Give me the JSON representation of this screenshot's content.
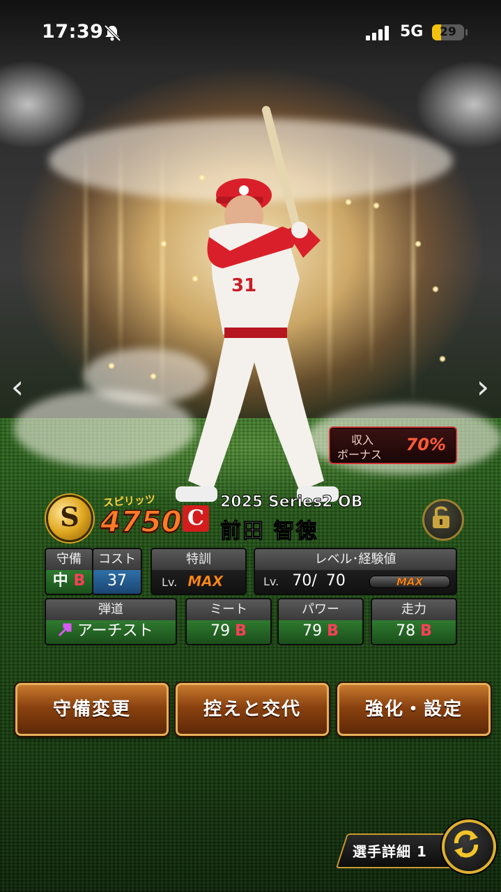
{
  "status_bar": {
    "time": "17:39",
    "network": "5G",
    "battery": "29",
    "battery_percent": 29,
    "icons": [
      "bell-muted-icon",
      "signal-icon",
      "battery-icon"
    ]
  },
  "navigation": {
    "prev": "‹",
    "next": "›"
  },
  "bonus": {
    "line1": "収入",
    "line2": "ボーナス",
    "value": "70%"
  },
  "player": {
    "spirit_label": "スピリッツ",
    "spirit_value": "4750",
    "team_logo_letter": "C",
    "series": "2025 Series2 OB",
    "name": "前田 智徳",
    "uniform_number": "31",
    "rank_letter": "S"
  },
  "stats": {
    "defense": {
      "label": "守備",
      "position": "中",
      "rank": "B"
    },
    "cost": {
      "label": "コスト",
      "value": "37"
    },
    "training": {
      "label": "特訓",
      "lv": "Lv.",
      "value": "MAX"
    },
    "level": {
      "label": "レベル･経験値",
      "lv": "Lv.",
      "current": "70/",
      "max": "70",
      "bar_label": "MAX"
    },
    "trajectory": {
      "label": "弾道",
      "value": "アーチスト"
    },
    "meet": {
      "label": "ミート",
      "value": "79",
      "rank": "B"
    },
    "power": {
      "label": "パワー",
      "value": "79",
      "rank": "B"
    },
    "speed": {
      "label": "走力",
      "value": "78",
      "rank": "B"
    }
  },
  "buttons": {
    "defense_change": "守備変更",
    "bench_swap": "控えと交代",
    "enhance": "強化・設定"
  },
  "footer": {
    "detail_label": "選手詳細 1"
  },
  "colors": {
    "spirit_orange": "#ff7a28",
    "rank_b": "#ff3f5a",
    "max_orange": "#ff8c1a",
    "bonus_red": "#ff5a3a",
    "button_gold": "#e6b05a"
  }
}
